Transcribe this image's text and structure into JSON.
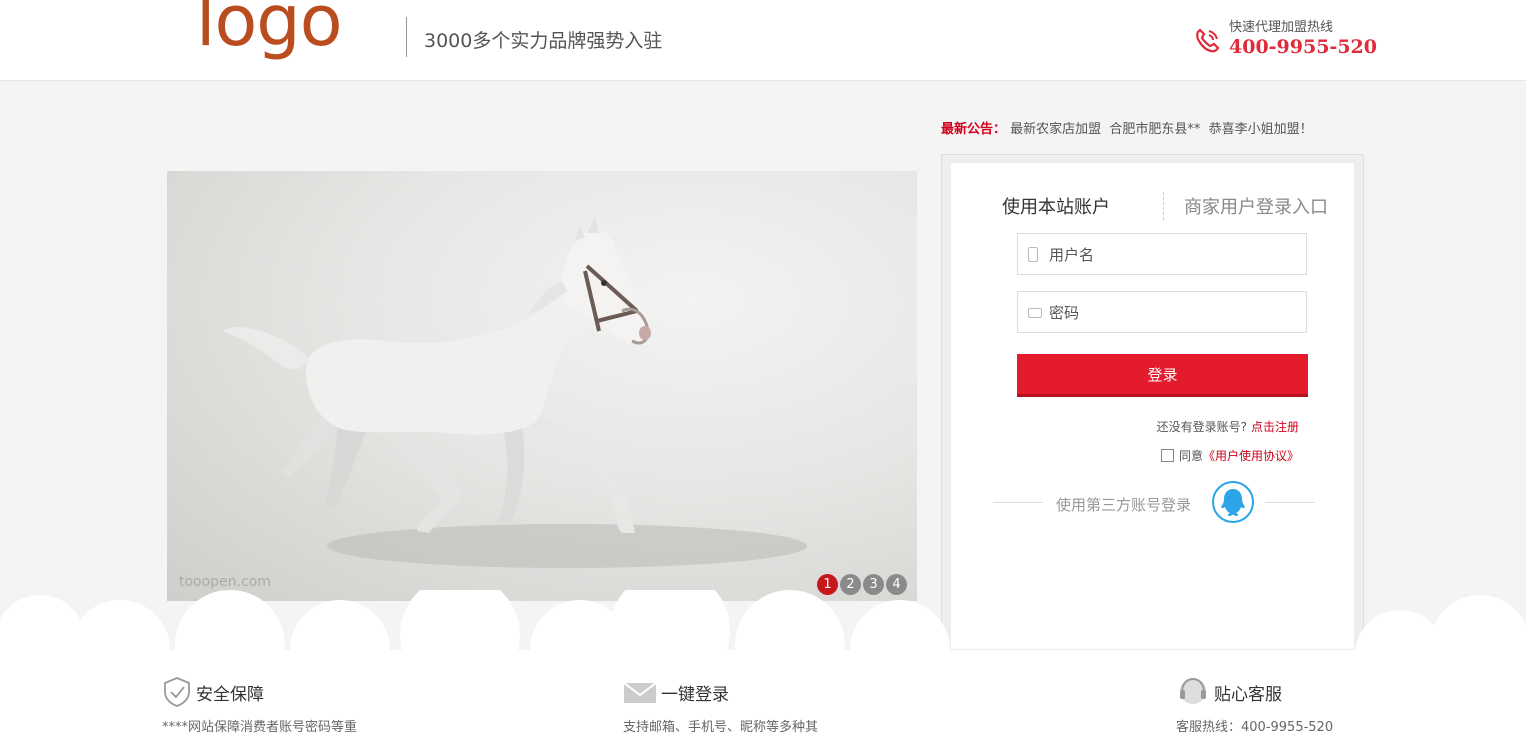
{
  "header": {
    "logo": "logo",
    "slogan": "3000多个实力品牌强势入驻",
    "hotline_label": "快速代理加盟热线",
    "hotline_number": "400-9955-520"
  },
  "notice": {
    "label": "最新公告：",
    "text": "最新农家店加盟  合肥市肥东县**  恭喜李小姐加盟！"
  },
  "banner": {
    "watermark": "tooopen.com",
    "slides": [
      "1",
      "2",
      "3",
      "4"
    ],
    "active_slide": 1
  },
  "login": {
    "tab_own": "使用本站账户",
    "tab_merchant": "商家用户登录入口",
    "username_placeholder": "用户名",
    "password_placeholder": "密码",
    "submit_label": "登录",
    "register_prompt": "还没有登录账号?",
    "register_link": "点击注册",
    "agree_prefix": "同意",
    "agree_link": "《用户使用协议》",
    "third_party_label": "使用第三方账号登录"
  },
  "features": [
    {
      "title": "安全保障",
      "desc": "****网站保障消费者账号密码等重",
      "icon": "shield-icon"
    },
    {
      "title": "一键登录",
      "desc": "支持邮箱、手机号、昵称等多种其",
      "icon": "mail-icon"
    },
    {
      "title": "贴心客服",
      "desc": "客服热线：400-9955-520",
      "icon": "headset-icon"
    }
  ],
  "colors": {
    "brand_red": "#e31b2d",
    "logo_orange": "#b94d20",
    "link_red": "#d0021b"
  }
}
